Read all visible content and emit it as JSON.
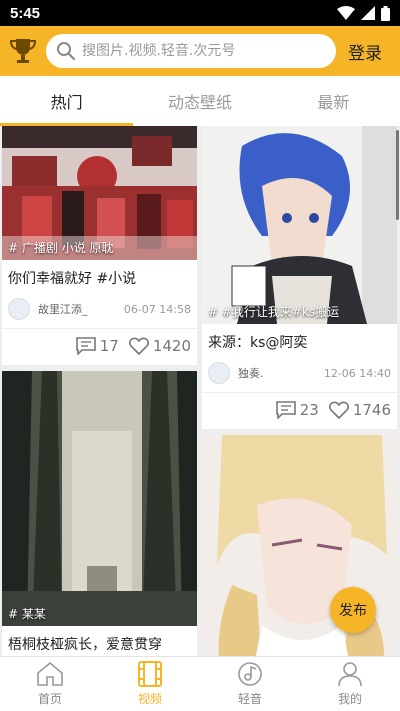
{
  "status_bar": {
    "time": "5:45"
  },
  "header": {
    "search_placeholder": "搜图片.视频.轻音.次元号",
    "login_label": "登录"
  },
  "tabs": [
    {
      "label": "热门",
      "active": true
    },
    {
      "label": "动态壁纸",
      "active": false
    },
    {
      "label": "最新",
      "active": false
    }
  ],
  "feed": {
    "left": [
      {
        "tag": "# 广播剧 小说 原耽",
        "caption": "你们幸福就好 #小说",
        "author": "故里江添_",
        "date": "06-07 14:58",
        "comments": "17",
        "likes": "1420"
      },
      {
        "tag": "# 某某",
        "caption": "梧桐枝桠疯长，爱意贯穿"
      }
    ],
    "right": [
      {
        "tag": "# #我行让我来#ks搬运",
        "caption": "来源：ks@阿奕",
        "author": "独奏.",
        "date": "12-06 14:40",
        "comments": "23",
        "likes": "1746"
      },
      {}
    ]
  },
  "fab_label": "发布",
  "bottom_nav": [
    {
      "label": "首页",
      "icon": "home-icon",
      "active": false
    },
    {
      "label": "视频",
      "icon": "film-icon",
      "active": true
    },
    {
      "label": "轻音",
      "icon": "music-note-icon",
      "active": false
    },
    {
      "label": "我的",
      "icon": "user-icon",
      "active": false
    }
  ],
  "colors": {
    "accent": "#f5b526",
    "background": "#eeeeee"
  }
}
